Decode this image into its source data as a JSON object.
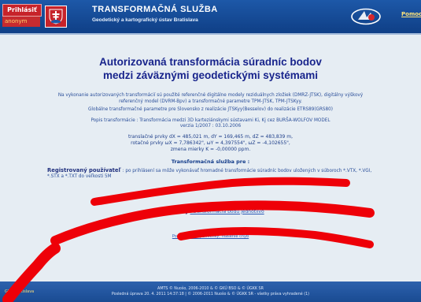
{
  "header": {
    "login_label": "Prihlásiť",
    "user_label": "anonym",
    "title": "TRANSFORMAČNÁ SLUŽBA",
    "subtitle": "Geodetický a kartografický ústav Bratislava",
    "help_link": "Pomoc"
  },
  "main": {
    "title_line1": "Autorizovaná transformácia súradníc bodov",
    "title_line2": "medzi záväznými geodetickými systémami",
    "intro": "Na vykonanie autorizovaných transformácií sú použité referenčné digitálne modely reziduálnych zložiek (DMRZ-JTSK), digitálny výškový referenčný model (DVRM-Bpv) a transformačné parametre TPM-JTSK, TPM-JTSKyy.",
    "global_params": "Globálne transformačné parametre pre Slovensko z realizácie JTSKyy(Besselov) do realizácie ETRS89(GRS80)",
    "description_line1": "Popis transformácie : Transformácia medzi 3D karteziánskymi sústavami Ki, Kj cez BURŠA-WOLFOV MODEL",
    "description_line2": "verzia 1/2007 : 03.10.2006",
    "params_line1_prefix": "translačné prvky",
    "params_line1": "dX = 485,021 m, dY = 169,465 m, dZ = 483,839 m,",
    "params_line2_prefix": "rotačné prvky",
    "params_line2": "ωX = 7,786342\", ωY = 4,397554\", ωZ = -4,102655\",",
    "params_line3": "zmena mierky K = -0,00000 ppm.",
    "service_for_title": "Transformačná služba pre :",
    "registered_user_label": "Registrovaný používateľ",
    "registered_user_text": ": po prihlásení sa môže vykonávať hromadné transformácie súradníc bodov uložených v súboroch *.VTX, *.VGI, *.STX a *.TXT do veľkosti 5M",
    "anonymous_label": "Anonymný",
    "anonymous_link": ": transformácia bodu jednotlivo",
    "notes_link": "Poznámky, pripomienky, hlásenie chýb"
  },
  "footer": {
    "left": "GKÚ Bratislava",
    "line1": "AMTS © Nuošo, 2006-2010 & © GKÚ BSO & © ÚGKK SR",
    "line2": "Posledná úprava 20. 4. 2011 14:37:18 | © 2006-2011 Nuošo & © ÚGKK SR - všetky práva vyhradené (1)"
  },
  "colors": {
    "header_bg": "#1d58a8",
    "title_color": "#18248c",
    "scribble": "#ee0008"
  },
  "icons": {
    "flag": "slovak-coat-of-arms-icon",
    "gis": "gis-logo"
  }
}
